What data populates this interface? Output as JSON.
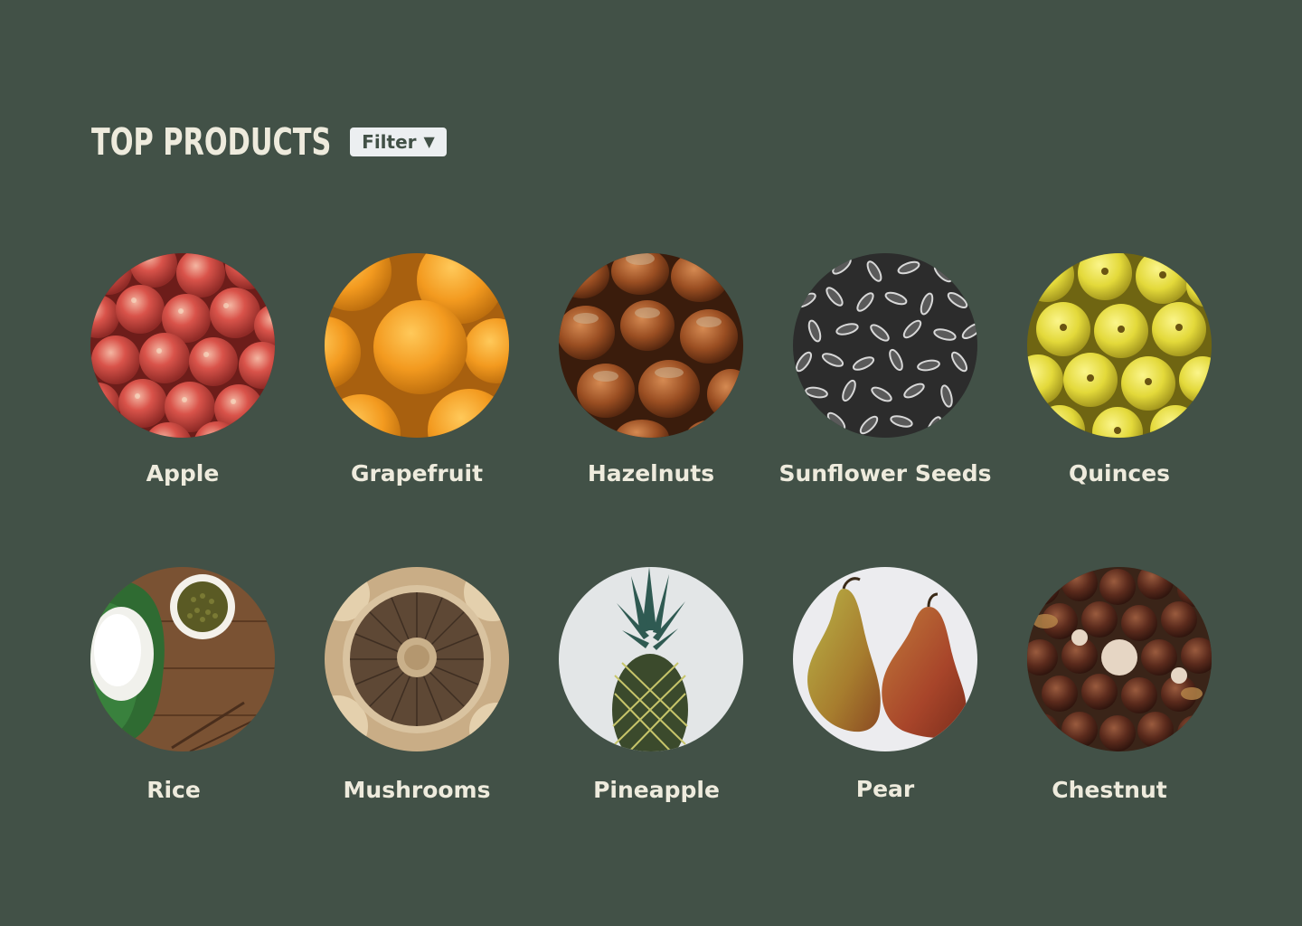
{
  "header": {
    "title": "TOP PRODUCTS",
    "filter_label": "Filter",
    "filter_icon": "caret-down-icon"
  },
  "colors": {
    "background": "#425147",
    "text": "#EEEBDD",
    "filter_background": "#ECEFF1"
  },
  "products": [
    {
      "label": "Apple",
      "image": "apple-image"
    },
    {
      "label": "Grapefruit",
      "image": "grapefruit-image"
    },
    {
      "label": "Hazelnuts",
      "image": "hazelnuts-image"
    },
    {
      "label": "Sunflower Seeds",
      "image": "sunflower-seeds-image"
    },
    {
      "label": "Quinces",
      "image": "quinces-image"
    },
    {
      "label": "Rice",
      "image": "rice-image"
    },
    {
      "label": "Mushrooms",
      "image": "mushrooms-image"
    },
    {
      "label": "Pineapple",
      "image": "pineapple-image"
    },
    {
      "label": "Pear",
      "image": "pear-image"
    },
    {
      "label": "Chestnut",
      "image": "chestnut-image"
    }
  ]
}
